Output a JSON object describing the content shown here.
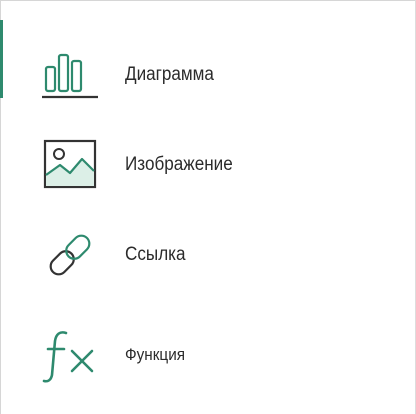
{
  "menu": {
    "accent_color": "#2e8a6e",
    "icon_dark_color": "#333333",
    "items": [
      {
        "label": "Диаграмма",
        "icon": "bar-chart-icon"
      },
      {
        "label": "Изображение",
        "icon": "image-icon"
      },
      {
        "label": "Ссылка",
        "icon": "link-icon"
      },
      {
        "label": "Функция",
        "icon": "function-fx-icon"
      }
    ]
  }
}
